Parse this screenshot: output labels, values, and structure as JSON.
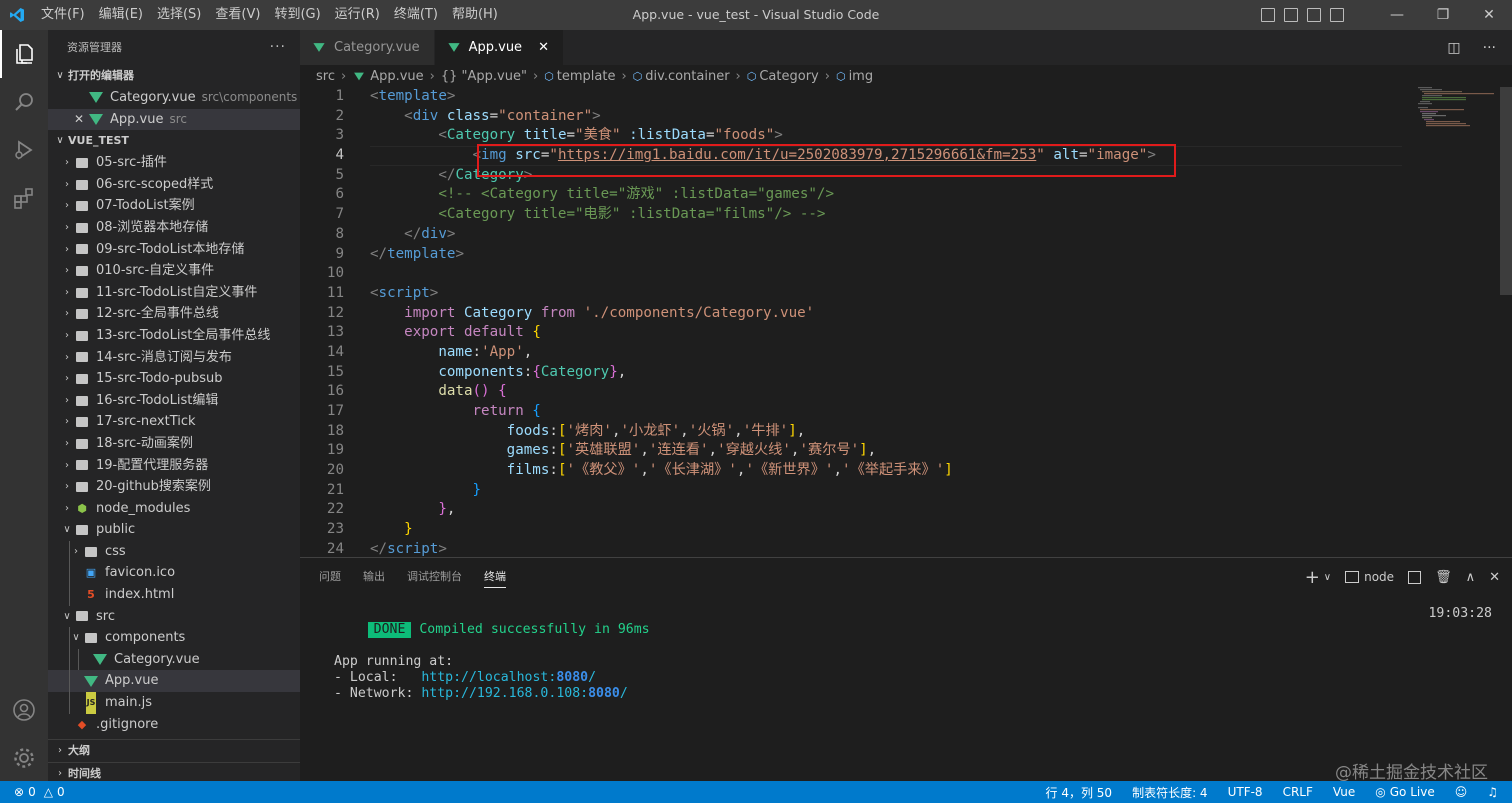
{
  "window": {
    "title": "App.vue - vue_test - Visual Studio Code"
  },
  "menu": [
    "文件(F)",
    "编辑(E)",
    "选择(S)",
    "查看(V)",
    "转到(G)",
    "运行(R)",
    "终端(T)",
    "帮助(H)"
  ],
  "sidebar": {
    "title": "资源管理器",
    "open_editors_label": "打开的编辑器",
    "open_editors": [
      {
        "name": "Category.vue",
        "desc": "src\\components"
      },
      {
        "name": "App.vue",
        "desc": "src"
      }
    ],
    "project_label": "VUE_TEST",
    "tree": [
      {
        "name": "05-src-插件",
        "type": "folder",
        "depth": 1,
        "open": false
      },
      {
        "name": "06-src-scoped样式",
        "type": "folder",
        "depth": 1,
        "open": false
      },
      {
        "name": "07-TodoList案例",
        "type": "folder",
        "depth": 1,
        "open": false
      },
      {
        "name": "08-浏览器本地存储",
        "type": "folder",
        "depth": 1,
        "open": false
      },
      {
        "name": "09-src-TodoList本地存储",
        "type": "folder",
        "depth": 1,
        "open": false
      },
      {
        "name": "010-src-自定义事件",
        "type": "folder",
        "depth": 1,
        "open": false
      },
      {
        "name": "11-src-TodoList自定义事件",
        "type": "folder",
        "depth": 1,
        "open": false
      },
      {
        "name": "12-src-全局事件总线",
        "type": "folder",
        "depth": 1,
        "open": false
      },
      {
        "name": "13-src-TodoList全局事件总线",
        "type": "folder",
        "depth": 1,
        "open": false
      },
      {
        "name": "14-src-消息订阅与发布",
        "type": "folder",
        "depth": 1,
        "open": false
      },
      {
        "name": "15-src-Todo-pubsub",
        "type": "folder",
        "depth": 1,
        "open": false
      },
      {
        "name": "16-src-TodoList编辑",
        "type": "folder",
        "depth": 1,
        "open": false
      },
      {
        "name": "17-src-nextTick",
        "type": "folder",
        "depth": 1,
        "open": false
      },
      {
        "name": "18-src-动画案例",
        "type": "folder",
        "depth": 1,
        "open": false
      },
      {
        "name": "19-配置代理服务器",
        "type": "folder",
        "depth": 1,
        "open": false
      },
      {
        "name": "20-github搜索案例",
        "type": "folder",
        "depth": 1,
        "open": false
      },
      {
        "name": "node_modules",
        "type": "node",
        "depth": 1,
        "open": false
      },
      {
        "name": "public",
        "type": "folder",
        "depth": 1,
        "open": true
      },
      {
        "name": "css",
        "type": "folder",
        "depth": 2,
        "open": false
      },
      {
        "name": "favicon.ico",
        "type": "ico",
        "depth": 2
      },
      {
        "name": "index.html",
        "type": "html",
        "depth": 2
      },
      {
        "name": "src",
        "type": "folder",
        "depth": 1,
        "open": true
      },
      {
        "name": "components",
        "type": "folder",
        "depth": 2,
        "open": true
      },
      {
        "name": "Category.vue",
        "type": "vue",
        "depth": 3
      },
      {
        "name": "App.vue",
        "type": "vue",
        "depth": 2,
        "selected": true
      },
      {
        "name": "main.js",
        "type": "js",
        "depth": 2
      },
      {
        "name": ".gitignore",
        "type": "git",
        "depth": 1
      }
    ],
    "outline_label": "大纲",
    "timeline_label": "时间线"
  },
  "tabs": [
    {
      "label": "Category.vue",
      "active": false
    },
    {
      "label": "App.vue",
      "active": true
    }
  ],
  "breadcrumbs": [
    "src",
    "App.vue",
    "{} \"App.vue\"",
    "template",
    "div.container",
    "Category",
    "img"
  ],
  "code_lines": [
    {
      "n": "1",
      "html": "<span class='t-tag'>&lt;</span><span class='t-name'>template</span><span class='t-tag'>&gt;</span>"
    },
    {
      "n": "2",
      "html": "    <span class='t-tag'>&lt;</span><span class='t-name'>div</span> <span class='t-attr'>class</span><span class='t-w'>=</span><span class='t-str'>\"container\"</span><span class='t-tag'>&gt;</span>"
    },
    {
      "n": "3",
      "html": "        <span class='t-tag'>&lt;</span><span class='t-cmp'>Category</span> <span class='t-attr'>title</span><span class='t-w'>=</span><span class='t-str'>\"美食\"</span> <span class='t-attr'>:listData</span><span class='t-w'>=</span><span class='t-str'>\"foods\"</span><span class='t-tag'>&gt;</span>"
    },
    {
      "n": "4",
      "html": "            <span class='t-tag'>&lt;</span><span class='t-name'>img</span> <span class='t-attr'>src</span><span class='t-w'>=</span><span class='t-str'>\"<u>https://img1.baidu.com/it/u=2502083979,2715296661&amp;fm=253</u>\"</span> <span class='t-attr'>alt</span><span class='t-w'>=</span><span class='t-str'>\"image\"</span><span class='t-tag'>&gt;</span>",
      "cur": true
    },
    {
      "n": "5",
      "html": "        <span class='t-tag'>&lt;/</span><span class='t-cmp'>Category</span><span class='t-tag'>&gt;</span>"
    },
    {
      "n": "6",
      "html": "        <span class='t-com'>&lt;!-- &lt;Category title=\"游戏\" :listData=\"games\"/&gt;</span>"
    },
    {
      "n": "7",
      "html": "<span class='t-com'>        &lt;Category title=\"电影\" :listData=\"films\"/&gt; --&gt;</span>"
    },
    {
      "n": "8",
      "html": "    <span class='t-tag'>&lt;/</span><span class='t-name'>div</span><span class='t-tag'>&gt;</span>"
    },
    {
      "n": "9",
      "html": "<span class='t-tag'>&lt;/</span><span class='t-name'>template</span><span class='t-tag'>&gt;</span>"
    },
    {
      "n": "10",
      "html": ""
    },
    {
      "n": "11",
      "html": "<span class='t-tag'>&lt;</span><span class='t-name'>script</span><span class='t-tag'>&gt;</span>"
    },
    {
      "n": "12",
      "html": "    <span class='t-kw'>import</span> <span class='t-attr'>Category</span> <span class='t-kw'>from</span> <span class='t-str'>'./components/Category.vue'</span>"
    },
    {
      "n": "13",
      "html": "    <span class='t-kw'>export</span> <span class='t-kw'>default</span> <span class='t-br'>{</span>"
    },
    {
      "n": "14",
      "html": "        <span class='t-attr'>name</span><span class='t-w'>:</span><span class='t-str'>'App'</span><span class='t-w'>,</span>"
    },
    {
      "n": "15",
      "html": "        <span class='t-attr'>components</span><span class='t-w'>:</span><span class='t-br2'>{</span><span class='t-cmp'>Category</span><span class='t-br2'>}</span><span class='t-w'>,</span>"
    },
    {
      "n": "16",
      "html": "        <span class='t-fn'>data</span><span class='t-br2'>()</span> <span class='t-br2'>{</span>"
    },
    {
      "n": "17",
      "html": "            <span class='t-kw'>return</span> <span class='t-br3'>{</span>"
    },
    {
      "n": "18",
      "html": "                <span class='t-attr'>foods</span><span class='t-w'>:</span><span class='t-br'>[</span><span class='t-str'>'烤肉'</span><span class='t-w'>,</span><span class='t-str'>'小龙虾'</span><span class='t-w'>,</span><span class='t-str'>'火锅'</span><span class='t-w'>,</span><span class='t-str'>'牛排'</span><span class='t-br'>]</span><span class='t-w'>,</span>"
    },
    {
      "n": "19",
      "html": "                <span class='t-attr'>games</span><span class='t-w'>:</span><span class='t-br'>[</span><span class='t-str'>'英雄联盟'</span><span class='t-w'>,</span><span class='t-str'>'连连看'</span><span class='t-w'>,</span><span class='t-str'>'穿越火线'</span><span class='t-w'>,</span><span class='t-str'>'赛尔号'</span><span class='t-br'>]</span><span class='t-w'>,</span>"
    },
    {
      "n": "20",
      "html": "                <span class='t-attr'>films</span><span class='t-w'>:</span><span class='t-br'>[</span><span class='t-str'>'《教父》'</span><span class='t-w'>,</span><span class='t-str'>'《长津湖》'</span><span class='t-w'>,</span><span class='t-str'>'《新世界》'</span><span class='t-w'>,</span><span class='t-str'>'《举起手来》'</span><span class='t-br'>]</span>"
    },
    {
      "n": "21",
      "html": "            <span class='t-br3'>}</span>"
    },
    {
      "n": "22",
      "html": "        <span class='t-br2'>}</span><span class='t-w'>,</span>"
    },
    {
      "n": "23",
      "html": "    <span class='t-br'>}</span>"
    },
    {
      "n": "24",
      "html": "<span class='t-tag'>&lt;/</span><span class='t-name'>script</span><span class='t-tag'>&gt;</span>"
    }
  ],
  "panel": {
    "tabs": [
      "问题",
      "输出",
      "调试控制台",
      "终端"
    ],
    "active_tab": "终端",
    "terminal_name": "node",
    "timestamp": "19:03:28",
    "done_label": "DONE",
    "compiled_msg": "Compiled successfully in 96ms",
    "app_running": "App running at:",
    "local_label": "- Local:   ",
    "local_url_prefix": "http://localhost:",
    "local_port": "8080",
    "network_label": "- Network: ",
    "network_url_prefix": "http://192.168.0.108:",
    "network_port": "8080",
    "url_suffix": "/"
  },
  "status": {
    "errors": "0",
    "warnings": "0",
    "position": "行 4，列 50",
    "tab_size": "制表符长度: 4",
    "encoding": "UTF-8",
    "eol": "CRLF",
    "language": "Vue",
    "golive": "Go Live"
  },
  "watermark": "@稀土掘金技术社区",
  "colors": {
    "accent": "#007acc",
    "vue": "#41b883",
    "highlight_box": "#e01b1b"
  }
}
